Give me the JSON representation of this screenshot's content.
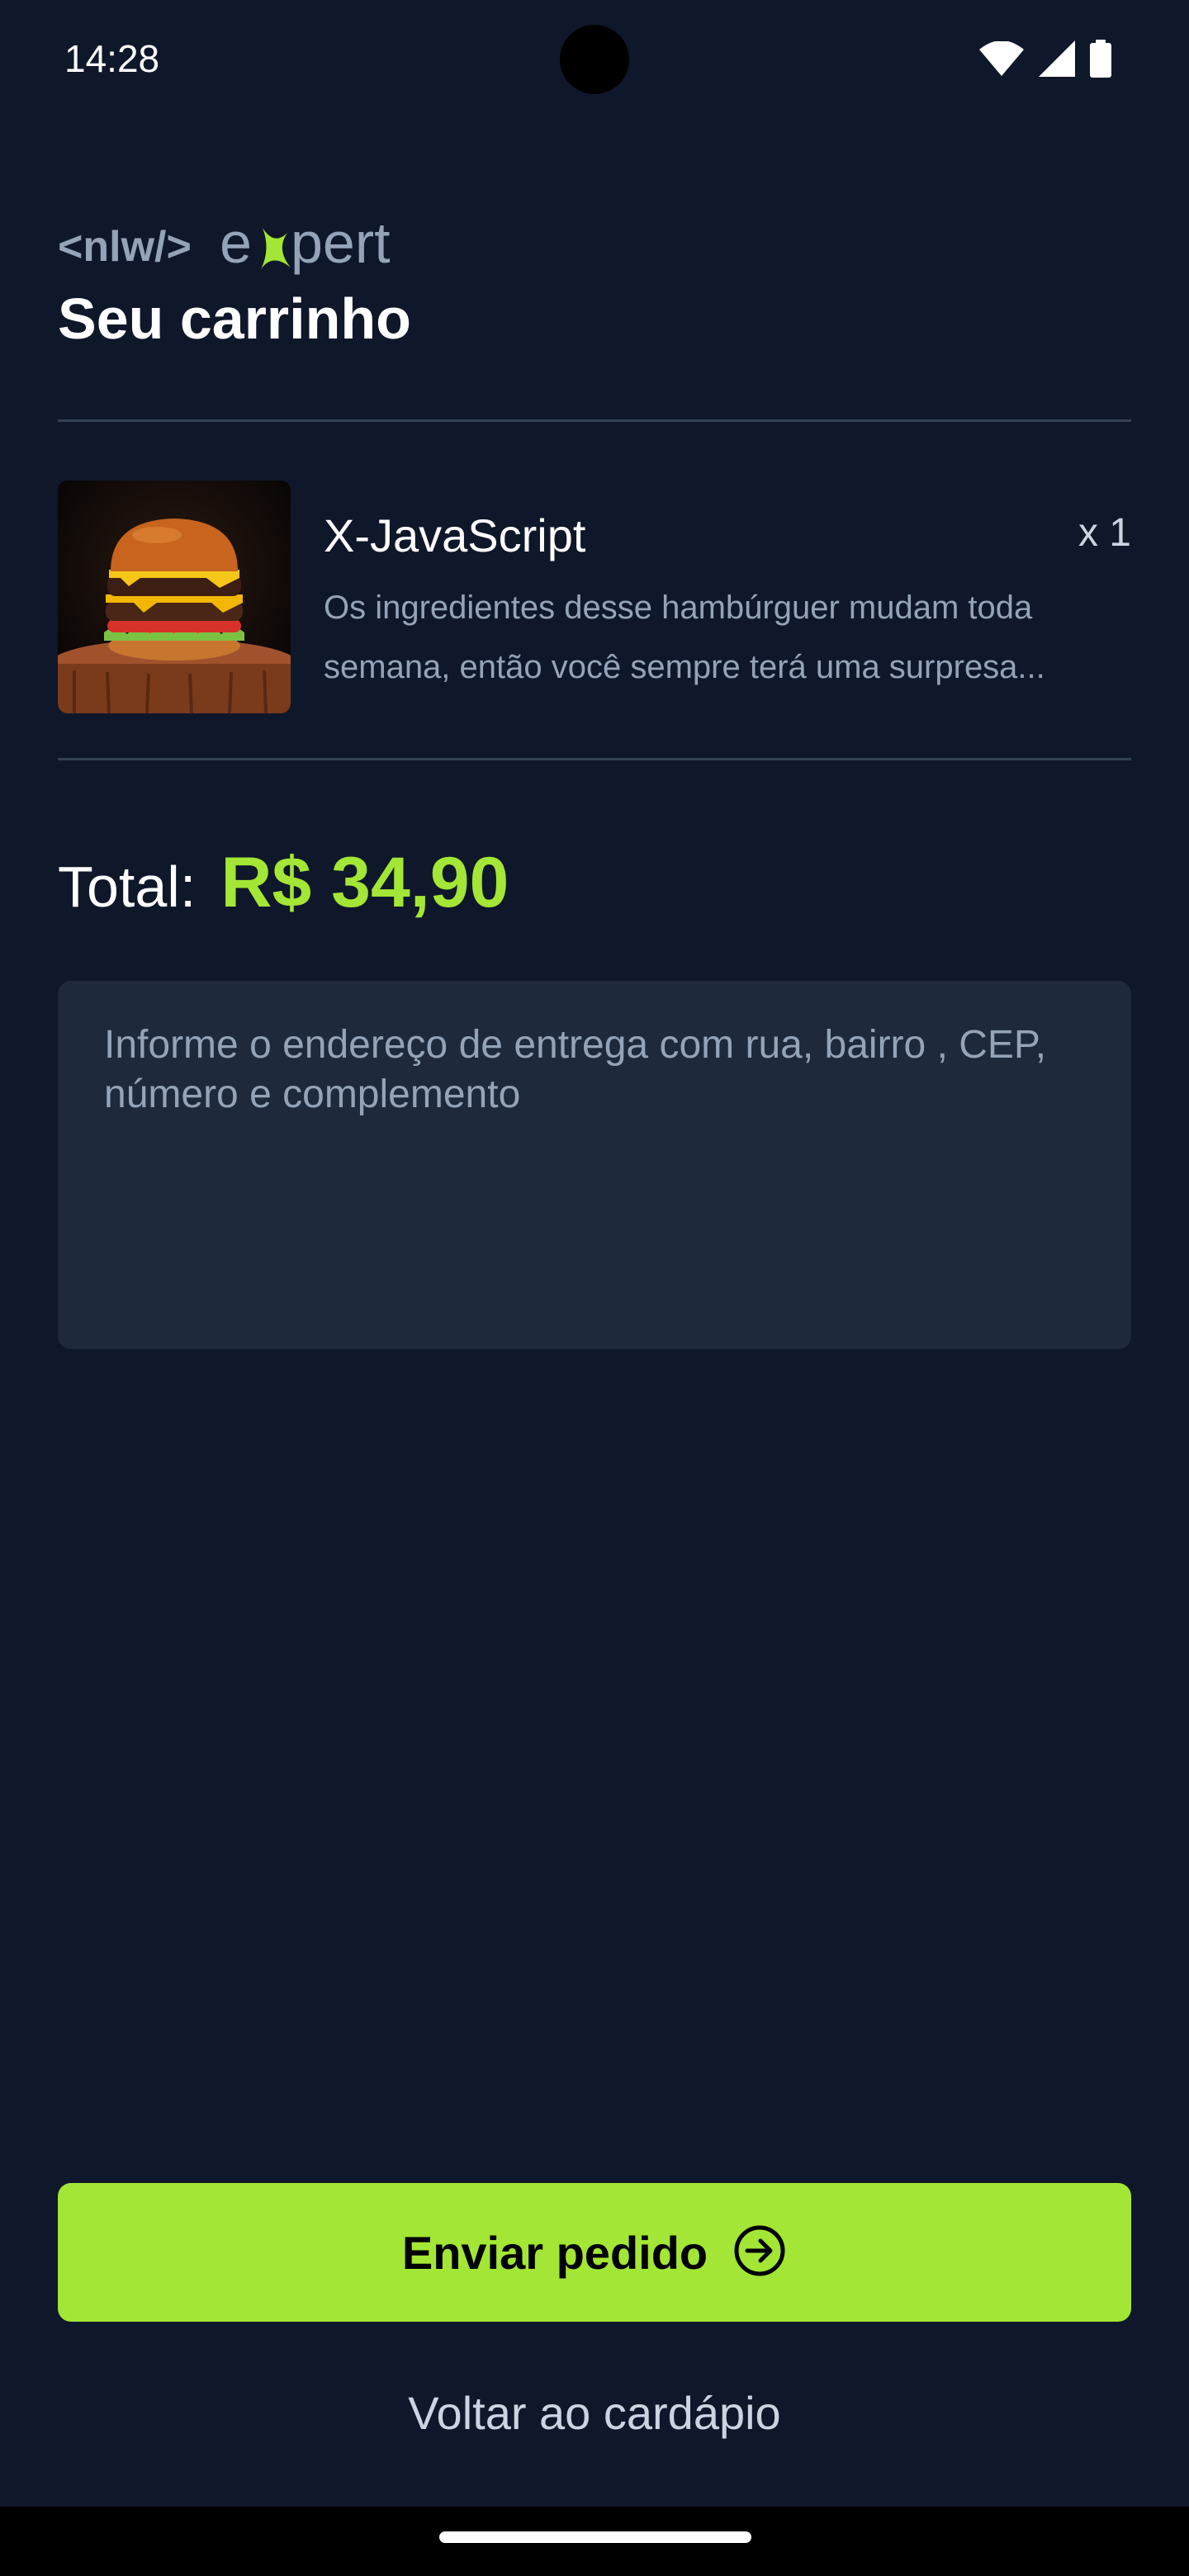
{
  "status_bar": {
    "time": "14:28",
    "icons": [
      "wifi-icon",
      "signal-icon",
      "battery-icon"
    ]
  },
  "header": {
    "logo_text": "<nlw/> expert",
    "title": "Seu carrinho"
  },
  "cart": {
    "items": [
      {
        "name": "X-JavaScript",
        "quantity": "x 1",
        "description": "Os ingredientes desse hambúrguer mudam toda semana, então você sempre terá uma surpresa...",
        "image": "burger-photo"
      }
    ]
  },
  "total": {
    "label": "Total:",
    "value": "R$ 34,90"
  },
  "address": {
    "placeholder": "Informe o endereço de entrega com rua, bairro , CEP, número e complemento",
    "value": ""
  },
  "actions": {
    "send_label": "Enviar pedido",
    "send_icon": "arrow-circle-right-icon",
    "back_label": "Voltar ao cardápio"
  },
  "colors": {
    "background": "#0f172a",
    "surface": "#1e293b",
    "accent": "#a3e635",
    "divider": "#334155"
  }
}
